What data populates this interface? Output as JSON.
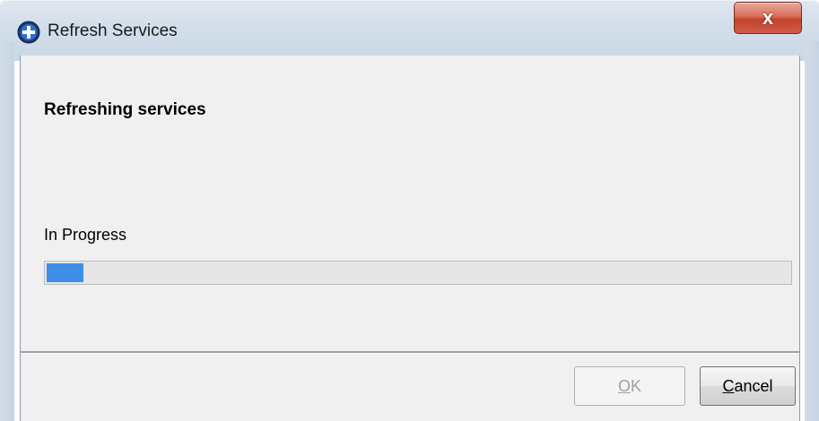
{
  "window": {
    "title": "Refresh Services",
    "close_label": "x"
  },
  "dialog": {
    "heading": "Refreshing services",
    "progress_label": "In Progress",
    "progress_fraction": 0.05
  },
  "buttons": {
    "ok": {
      "first": "O",
      "rest": "K",
      "enabled": false
    },
    "cancel": {
      "first": "C",
      "rest": "ancel",
      "enabled": true
    }
  },
  "colors": {
    "progress_fill": "#3e8ee8",
    "close_button": "#c0422c",
    "dialog_background": "#f0f0f0"
  },
  "icons": {
    "app": "plus-circle-icon",
    "close": "close-icon"
  }
}
